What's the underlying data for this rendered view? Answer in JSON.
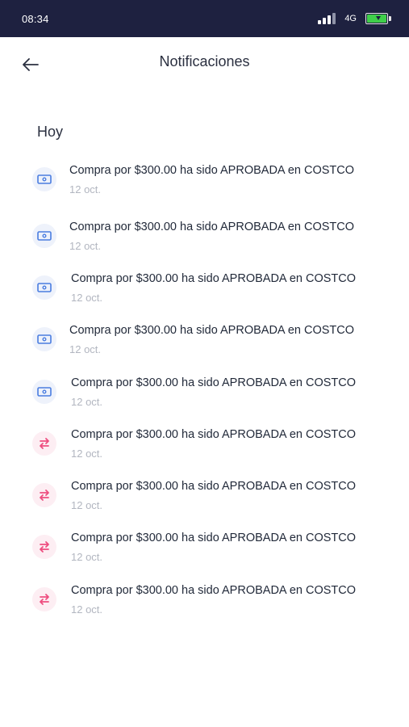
{
  "status_bar": {
    "time": "08:34",
    "network": "4G",
    "icons": [
      "signal-icon",
      "battery-icon"
    ],
    "battery_color": "#3fcf4a"
  },
  "header": {
    "back_icon": "arrow-left-icon",
    "title": "Notificaciones"
  },
  "section": {
    "title": "Hoy"
  },
  "colors": {
    "status_bar_bg": "#1e2140",
    "card_icon": "#4a7de0",
    "transfer_icon": "#ee4e80",
    "date_text": "#b2b6c0"
  },
  "notifications": [
    {
      "icon": "card-icon",
      "text": "Compra por $300.00 ha sido APROBADA en COSTCO",
      "date": "12 oct."
    },
    {
      "icon": "card-icon",
      "text": "Compra por $300.00 ha sido APROBADA en COSTCO",
      "date": "12 oct."
    },
    {
      "icon": "card-icon",
      "text": "Compra por $300.00 ha sido APROBADA en COSTCO",
      "date": "12 oct."
    },
    {
      "icon": "card-icon",
      "text": "Compra por $300.00 ha sido APROBADA en COSTCO",
      "date": "12 oct."
    },
    {
      "icon": "card-icon",
      "text": "Compra por $300.00 ha sido APROBADA en COSTCO",
      "date": "12 oct."
    },
    {
      "icon": "transfer-icon",
      "text": "Compra por $300.00 ha sido APROBADA en COSTCO",
      "date": "12 oct."
    },
    {
      "icon": "transfer-icon",
      "text": "Compra por $300.00 ha sido APROBADA en COSTCO",
      "date": "12 oct."
    },
    {
      "icon": "transfer-icon",
      "text": "Compra por $300.00 ha sido APROBADA en COSTCO",
      "date": "12 oct."
    },
    {
      "icon": "transfer-icon",
      "text": "Compra por $300.00 ha sido APROBADA en COSTCO",
      "date": "12 oct."
    }
  ]
}
